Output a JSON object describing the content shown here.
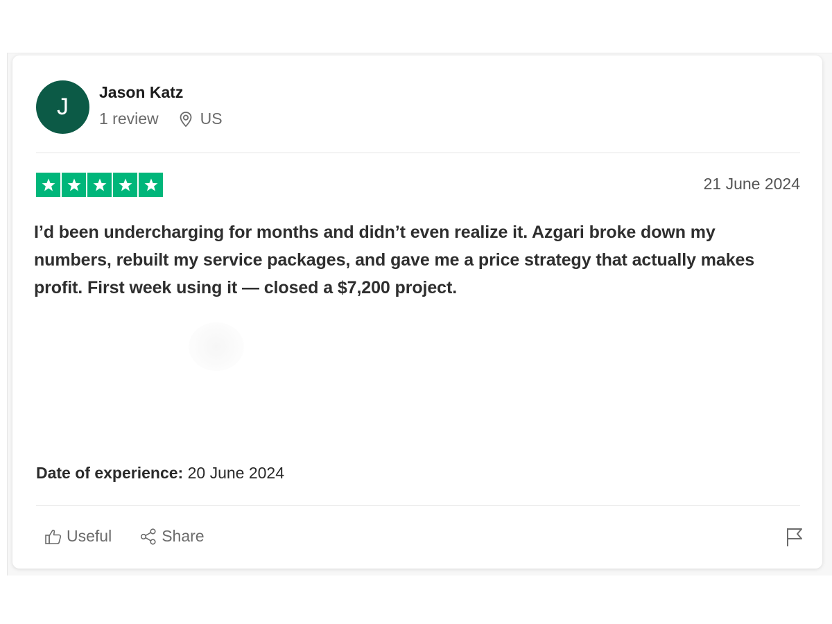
{
  "reviewer": {
    "initial": "J",
    "name": "Jason Katz",
    "review_count": "1 review",
    "country": "US"
  },
  "rating": {
    "stars": 5,
    "max": 5,
    "star_color": "#00b67a"
  },
  "review": {
    "date": "21 June 2024",
    "body": "I’d been undercharging for months and didn’t even realize it. Azgari broke down my numbers, rebuilt my service packages, and gave me a price strategy that actually makes profit. First week using it — closed a $7,200 project.",
    "experience_label": "Date of experience:",
    "experience_date": "20 June 2024"
  },
  "actions": {
    "useful_label": "Useful",
    "share_label": "Share"
  },
  "icons": {
    "location": "location-pin-icon",
    "useful": "thumbs-up-icon",
    "share": "share-icon",
    "flag": "flag-icon",
    "star": "star-icon"
  },
  "colors": {
    "avatar_bg": "#0c5a46",
    "star_green": "#00b67a"
  }
}
